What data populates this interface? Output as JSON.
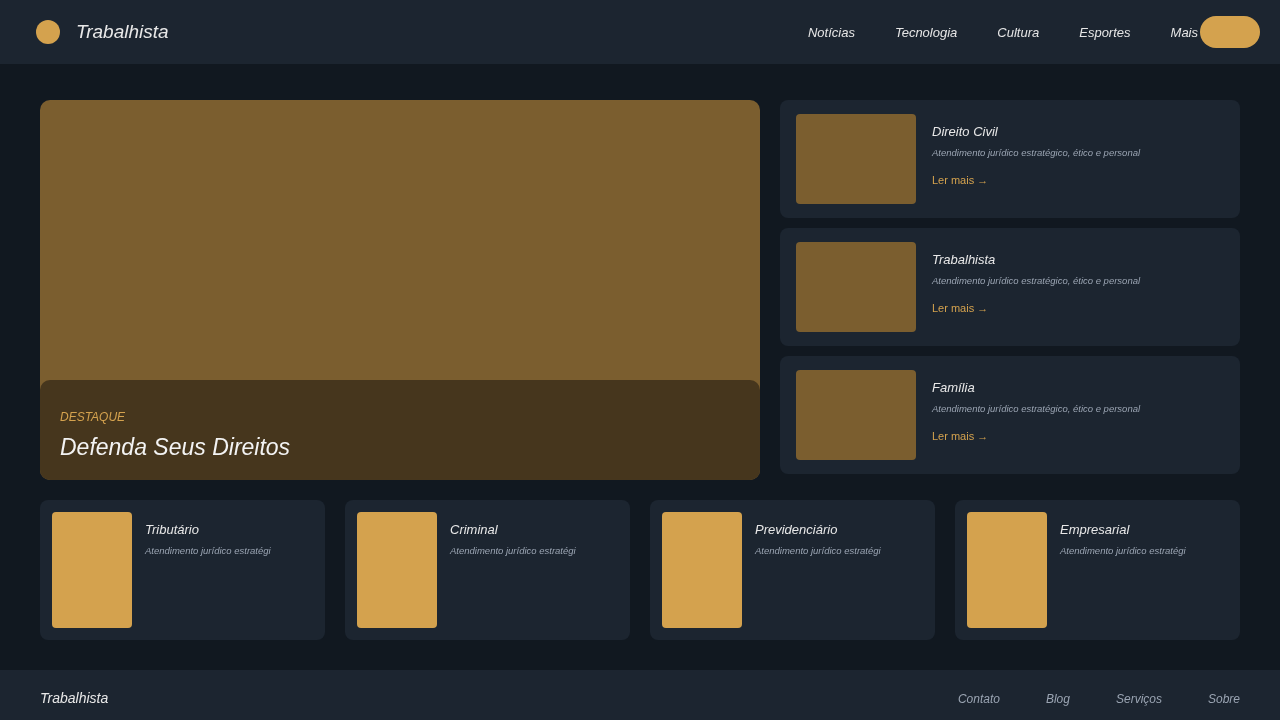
{
  "header": {
    "brand": "Trabalhista",
    "nav": [
      "Notícias",
      "Tecnologia",
      "Cultura",
      "Esportes",
      "Mais"
    ]
  },
  "hero": {
    "kicker": "DESTAQUE",
    "title": "Defenda Seus Direitos"
  },
  "side_cards": [
    {
      "title": "Direito Civil",
      "text": "Atendimento jurídico estratégico, ético e personal",
      "link": "Ler mais →"
    },
    {
      "title": "Trabalhista",
      "text": "Atendimento jurídico estratégico, ético e personal",
      "link": "Ler mais →"
    },
    {
      "title": "Família",
      "text": "Atendimento jurídico estratégico, ético e personal",
      "link": "Ler mais →"
    }
  ],
  "cards": [
    {
      "title": "Tributário",
      "text": "Atendimento jurídico estratégi"
    },
    {
      "title": "Criminal",
      "text": "Atendimento jurídico estratégi"
    },
    {
      "title": "Previdenciário",
      "text": "Atendimento jurídico estratégi"
    },
    {
      "title": "Empresarial",
      "text": "Atendimento jurídico estratégi"
    }
  ],
  "footer": {
    "brand": "Trabalhista",
    "links": [
      "Contato",
      "Blog",
      "Serviços",
      "Sobre"
    ]
  }
}
